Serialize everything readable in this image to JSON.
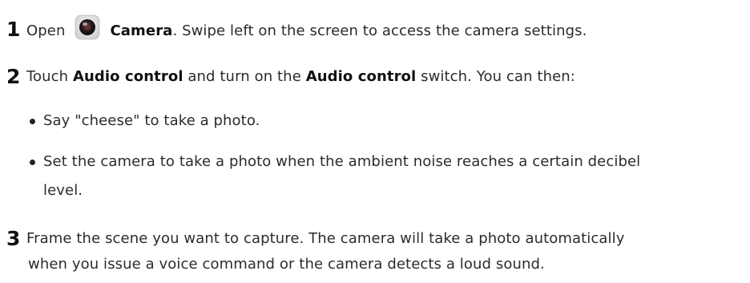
{
  "steps": [
    {
      "number": "1",
      "pre": "Open",
      "icon": "camera-app-icon",
      "bold": "Camera",
      "post": ". Swipe left on the screen to access the camera settings."
    },
    {
      "number": "2",
      "pre": "Touch ",
      "bold1": "Audio control",
      "mid": " and turn on the ",
      "bold2": "Audio control",
      "post": " switch. You can then:",
      "bullets": [
        {
          "line1": "Say \"cheese\" to take a photo."
        },
        {
          "line1": "Set the camera to take a photo when the ambient noise reaches a certain decibel",
          "line2": "level."
        }
      ]
    },
    {
      "number": "3",
      "line1": "Frame the scene you want to capture. The camera will take a photo automatically",
      "line2": "when you issue a voice command or the camera detects a loud sound."
    }
  ]
}
